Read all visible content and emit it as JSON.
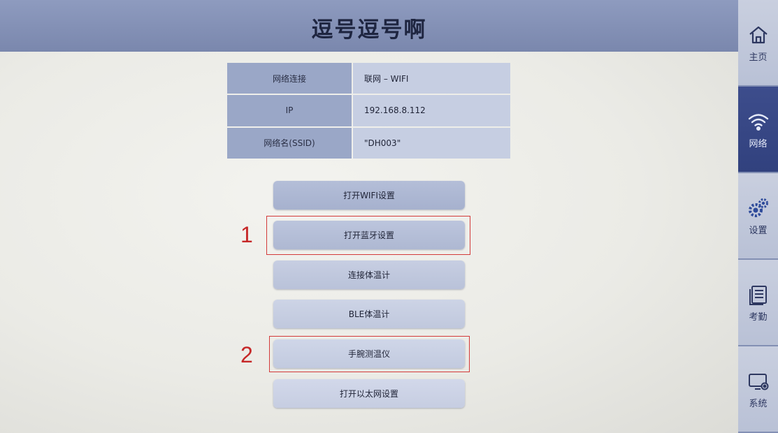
{
  "header": {
    "title": "逗号逗号啊"
  },
  "network_info": [
    {
      "label": "网络连接",
      "value": "联网 – WIFI"
    },
    {
      "label": "IP",
      "value": "192.168.8.112"
    },
    {
      "label": "网络名(SSID)",
      "value": "\"DH003\""
    }
  ],
  "buttons": {
    "open_wifi": "打开WIFI设置",
    "open_bluetooth": "打开蓝牙设置",
    "connect_thermometer": "连接体温计",
    "ble_thermometer": "BLE体温计",
    "wrist_thermometer": "手腕测温仪",
    "open_ethernet": "打开以太网设置"
  },
  "annotations": {
    "first": "1",
    "second": "2"
  },
  "sidebar": {
    "active": "network",
    "items": [
      {
        "label": "主页",
        "icon": "home-icon"
      },
      {
        "label": "网络",
        "icon": "wifi-icon"
      },
      {
        "label": "设置",
        "icon": "gear-icon"
      },
      {
        "label": "考勤",
        "icon": "attendance-icon"
      },
      {
        "label": "系统",
        "icon": "system-icon"
      }
    ]
  },
  "colors": {
    "header": "#8e9bbf",
    "sidebar_active": "#3d4d8c",
    "annotation": "#d33a3a"
  }
}
